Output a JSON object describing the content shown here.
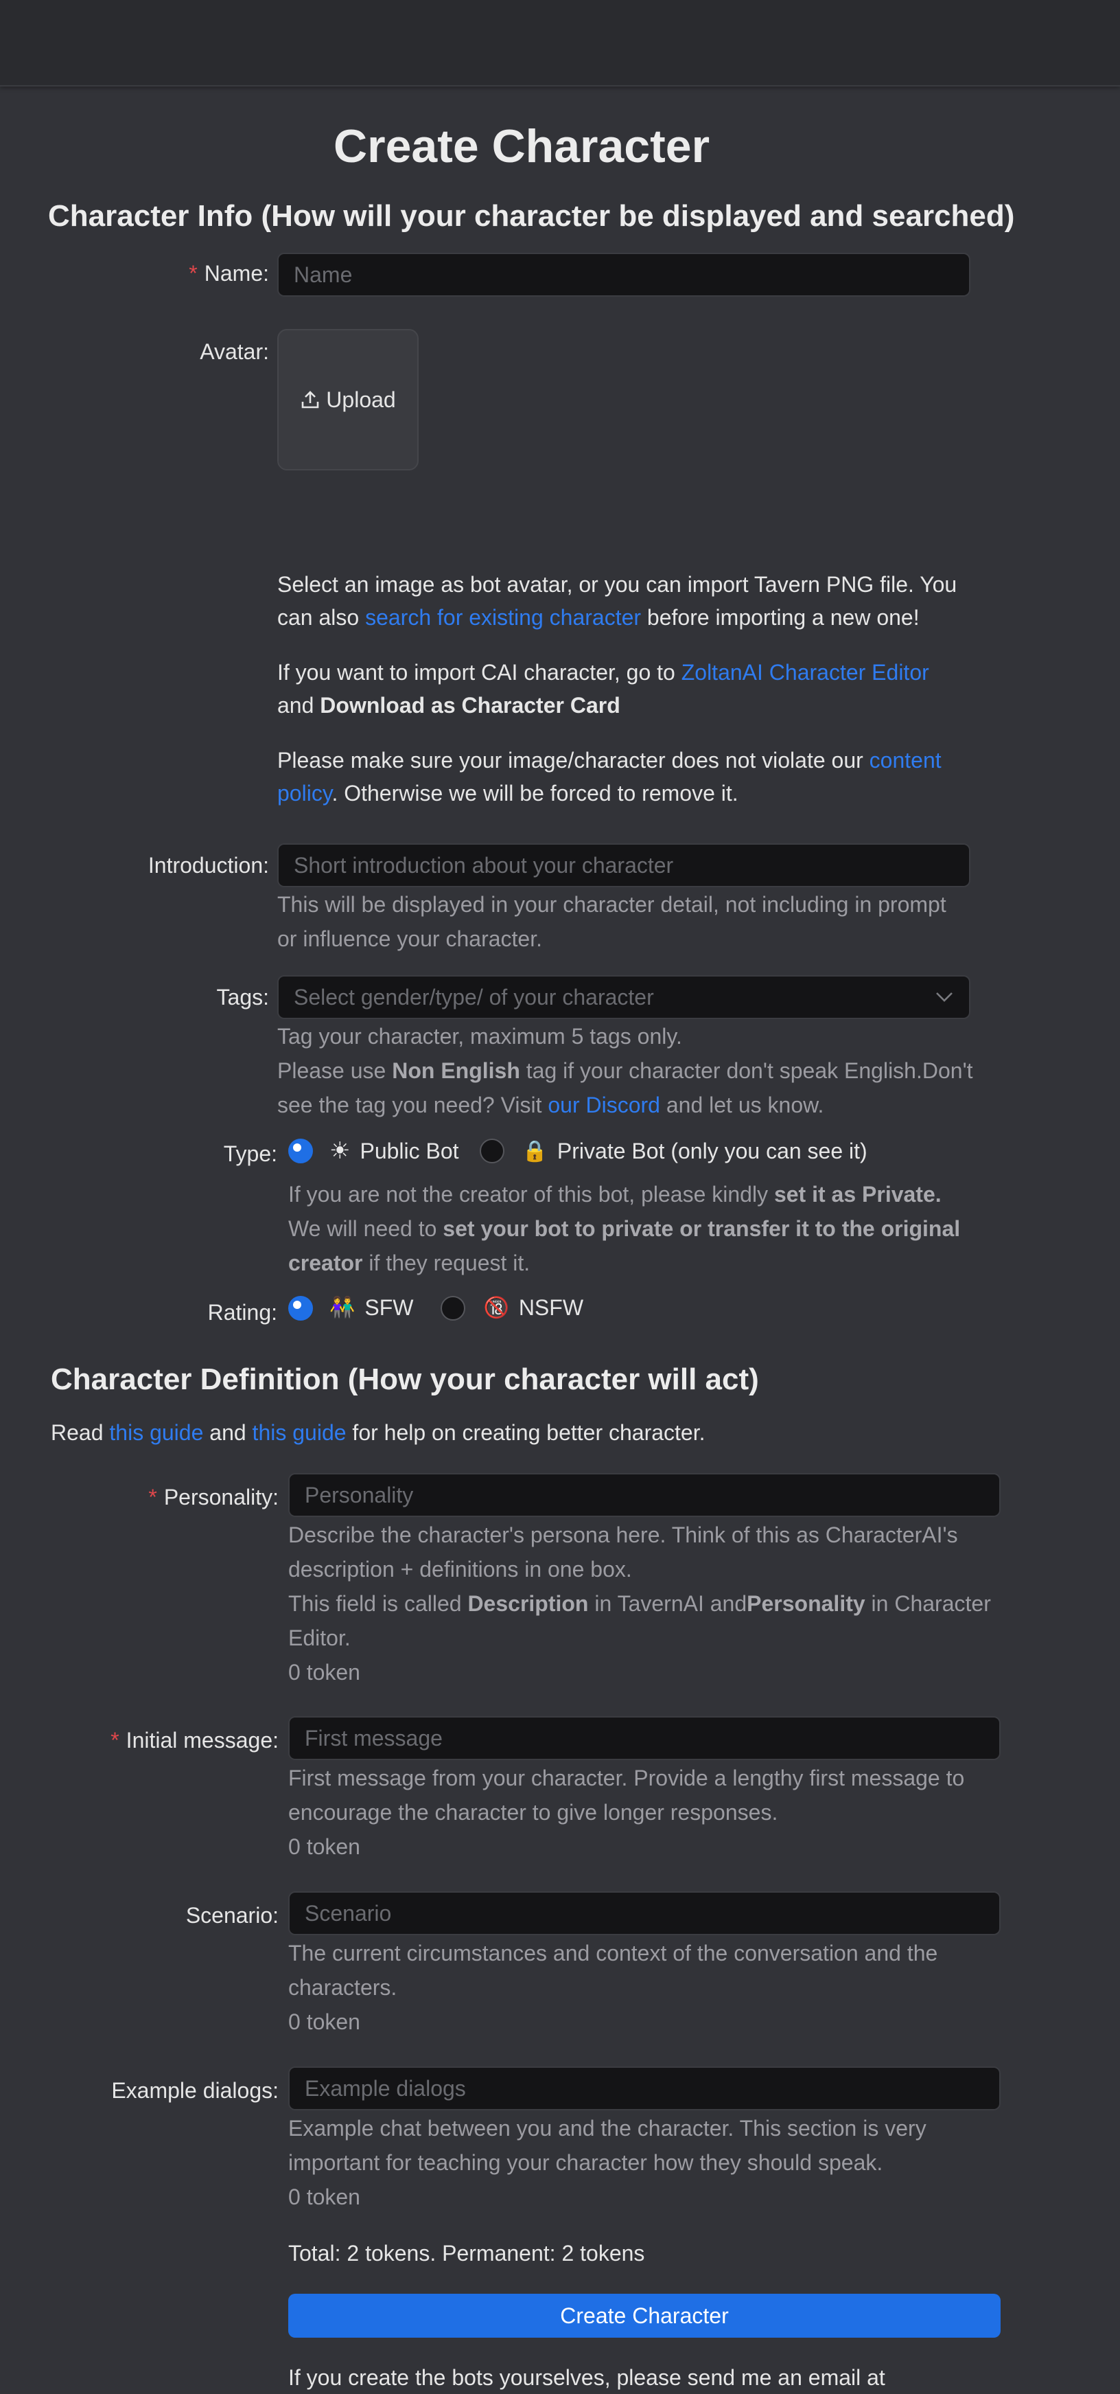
{
  "page_title": "Create Character",
  "info_section": {
    "heading": "Character Info (How will your character be displayed and searched)"
  },
  "name": {
    "label": "Name:",
    "placeholder": "Name"
  },
  "avatar": {
    "label": "Avatar:",
    "upload_label": "Upload",
    "help1_a": "Select an image as bot avatar, or you can import Tavern PNG file. You",
    "help1_b": "can also ",
    "help1_link": "search for existing character",
    "help1_c": " before importing a new one!",
    "help2_a": "If you want to import CAI character, go to ",
    "help2_link": "ZoltanAI Character Editor",
    "help2_b": "and ",
    "help2_bold": "Download as Character Card",
    "help3_a": "Please make sure your image/character does not violate our ",
    "help3_link1": "content",
    "help3_link2": "policy",
    "help3_b": ". Otherwise we will be forced to remove it."
  },
  "introduction": {
    "label": "Introduction:",
    "placeholder": "Short introduction about your character",
    "help1": "This will be displayed in your character detail, not including in prompt",
    "help2": "or influence your character."
  },
  "tags": {
    "label": "Tags:",
    "placeholder": "Select gender/type/ of your character",
    "help1": "Tag your character, maximum 5 tags only.",
    "help2_a": "Please use ",
    "help2_bold": "Non English",
    "help2_b": " tag if your character don't speak English.Don't",
    "help3_a": "see the tag you need? Visit ",
    "help3_link": "our Discord",
    "help3_b": " and let us know."
  },
  "type": {
    "label": "Type:",
    "option1": "Public Bot",
    "option2": "Private Bot (only you can see it)",
    "help1_a": "If you are not the creator of this bot, please kindly ",
    "help1_bold": "set it as Private.",
    "help2_a": "We will need to ",
    "help2_bold": "set your bot to private or transfer it to the original",
    "help3_bold": "creator",
    "help3_b": " if they request it."
  },
  "rating": {
    "label": "Rating:",
    "option1": "SFW",
    "option2": "NSFW"
  },
  "definition_section": {
    "heading": "Character Definition (How your character will act)",
    "guide_a": "Read ",
    "guide_link1": "this guide",
    "guide_b": " and ",
    "guide_link2": "this guide",
    "guide_c": " for help on creating better character."
  },
  "personality": {
    "label": "Personality:",
    "placeholder": "Personality",
    "help1": "Describe the character's persona here. Think of this as CharacterAI's",
    "help2": "description + definitions in one box.",
    "help3_a": "This field is called ",
    "help3_bold1": "Description",
    "help3_b": " in TavernAI and",
    "help3_bold2": "Personality",
    "help3_c": " in Character",
    "help4": "Editor.",
    "tokens": "0 token"
  },
  "initial_message": {
    "label": "Initial message:",
    "placeholder": "First message",
    "help1": "First message from your character. Provide a lengthy first message to",
    "help2": "encourage the character to give longer responses.",
    "tokens": "0 token"
  },
  "scenario": {
    "label": "Scenario:",
    "placeholder": "Scenario",
    "help1": "The current circumstances and context of the conversation and the",
    "help2": "characters.",
    "tokens": "0 token"
  },
  "example_dialogs": {
    "label": "Example dialogs:",
    "placeholder": "Example dialogs",
    "help1": "Example chat between you and the character. This section is very",
    "help2": "important for teaching your character how they should speak.",
    "tokens": "0 token"
  },
  "totals": "Total: 2 tokens. Permanent: 2 tokens",
  "submit_label": "Create Character",
  "footer_partial": "If you create the bots yourselves, please send me an email at"
}
